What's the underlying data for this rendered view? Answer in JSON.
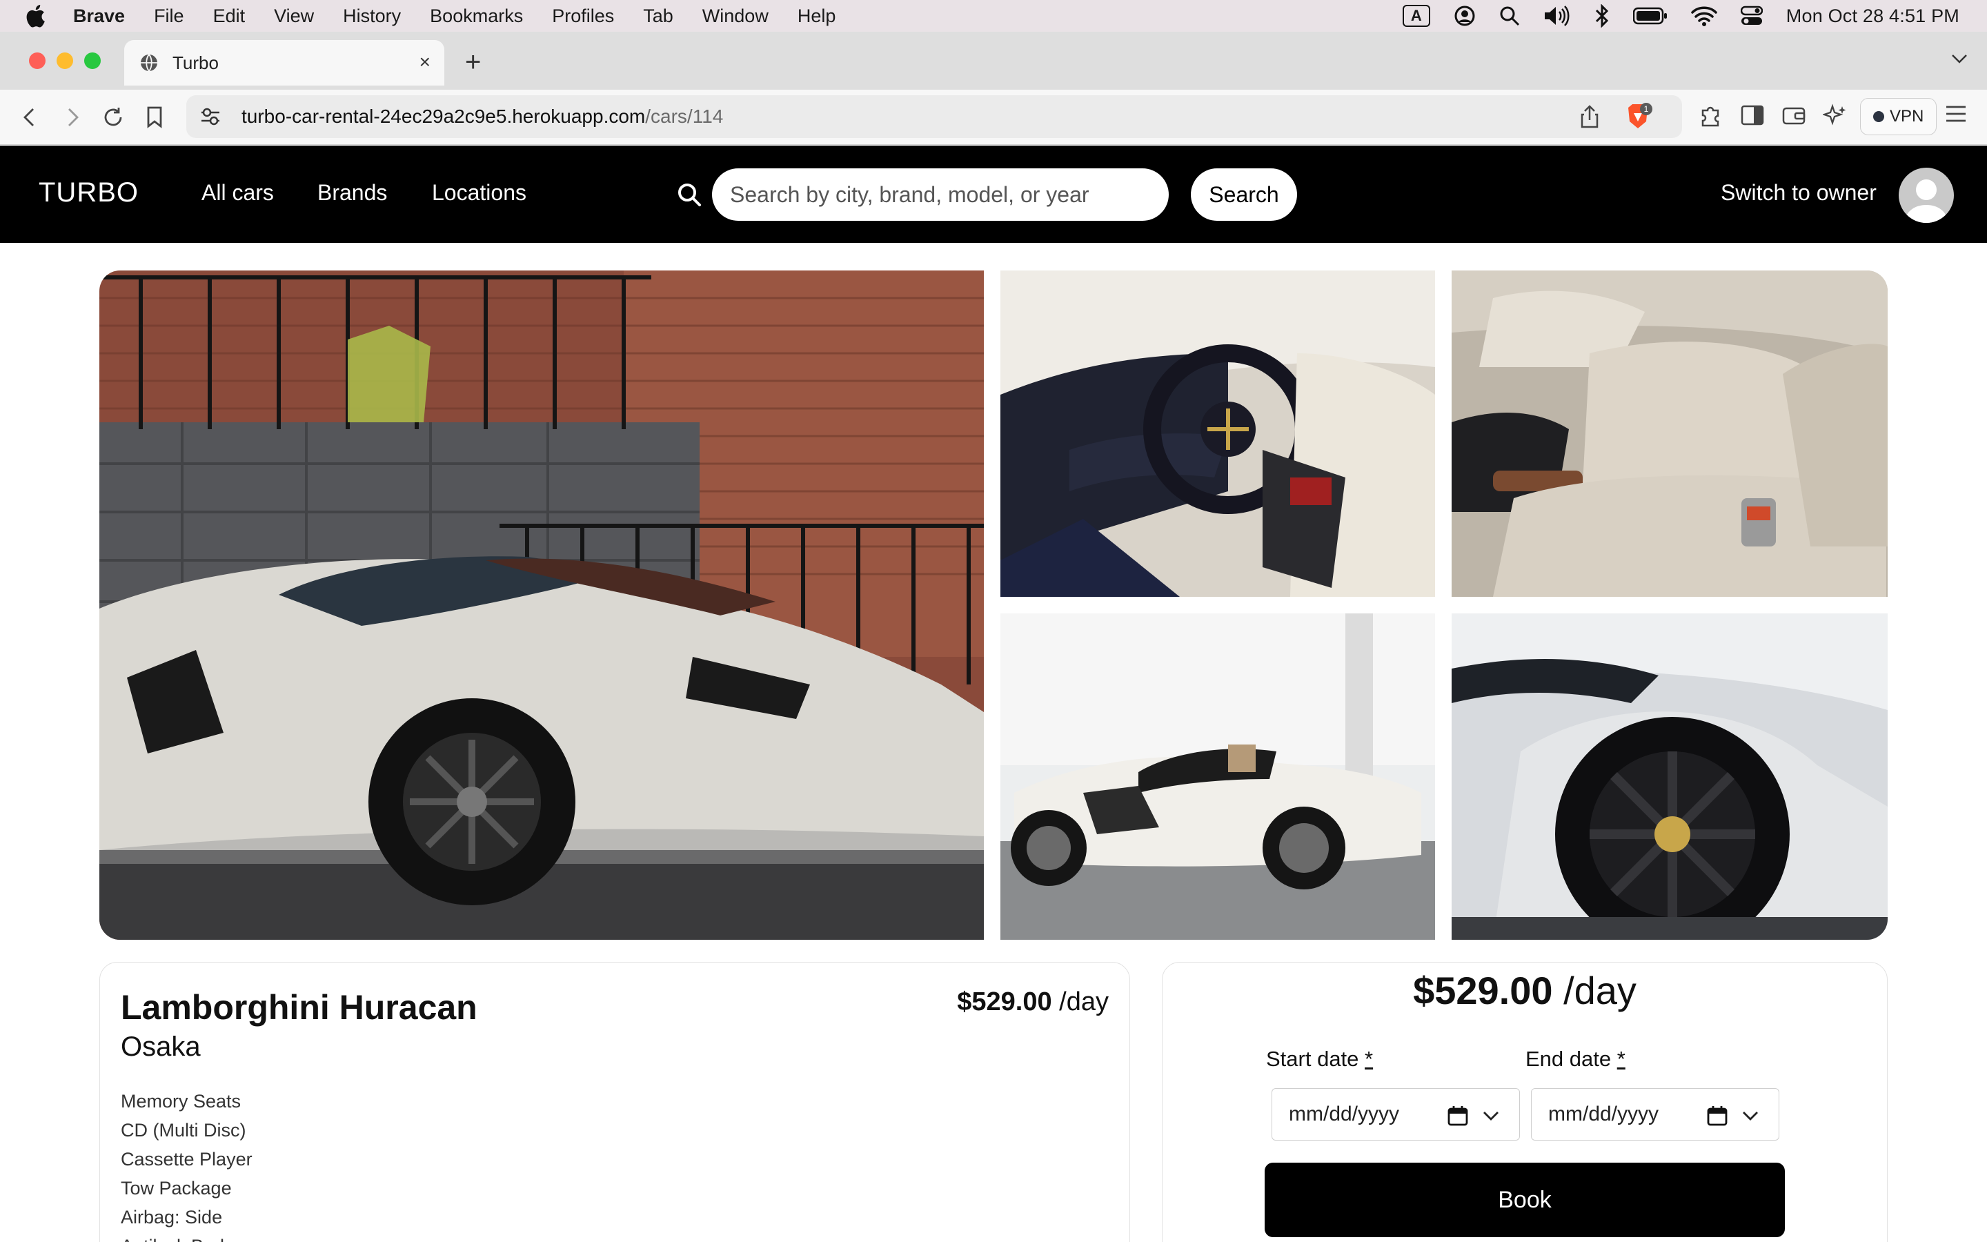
{
  "menubar": {
    "app": "Brave",
    "items": [
      "File",
      "Edit",
      "View",
      "History",
      "Bookmarks",
      "Profiles",
      "Tab",
      "Window",
      "Help"
    ],
    "input_badge": "A",
    "clock": "Mon Oct 28  4:51 PM"
  },
  "browser": {
    "tab_title": "Turbo",
    "tab_close": "×",
    "new_tab": "+",
    "url_host": "turbo-car-rental-24ec29a2c9e5.herokuapp.com",
    "url_path": "/cars/114",
    "shield_count": "1",
    "vpn_label": "VPN"
  },
  "site": {
    "logo": "TURBO",
    "nav": [
      "All cars",
      "Brands",
      "Locations"
    ],
    "search_placeholder": "Search by city, brand, model, or year",
    "search_button": "Search",
    "switch_owner": "Switch to owner"
  },
  "car": {
    "name": "Lamborghini Huracan",
    "city": "Osaka",
    "price": "$529.00",
    "per_day": " /day",
    "features": [
      "Memory Seats",
      "CD (Multi Disc)",
      "Cassette Player",
      "Tow Package",
      "Airbag: Side",
      "Antilock Brakes"
    ]
  },
  "booking": {
    "price": "$529.00",
    "per_day": " /day",
    "start_label": "Start date ",
    "end_label": "End date ",
    "required_mark": "*",
    "date_placeholder": "mm/dd/yyyy",
    "book_button": "Book"
  },
  "colors": {
    "nav_bg": "#000000",
    "accent": "#000000",
    "brave_orange": "#fb542b"
  }
}
